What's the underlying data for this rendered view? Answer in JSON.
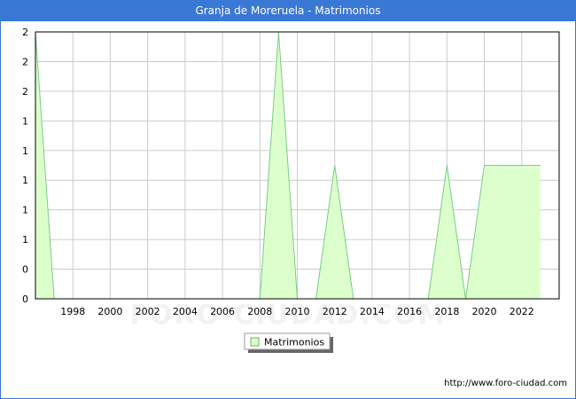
{
  "header": {
    "title": "Granja de Moreruela - Matrimonios"
  },
  "watermark": "FORO-CIUDAD.COM",
  "footer": {
    "url": "http://www.foro-ciudad.com"
  },
  "colors": {
    "fill": "#ddffcc",
    "line": "#77cc88",
    "title_bg": "#3a78d6",
    "grid": "#cccccc"
  },
  "chart_data": {
    "type": "area",
    "title": "Granja de Moreruela - Matrimonios",
    "x": [
      1996,
      1997,
      1998,
      1999,
      2000,
      2001,
      2002,
      2003,
      2004,
      2005,
      2006,
      2007,
      2008,
      2009,
      2010,
      2011,
      2012,
      2013,
      2014,
      2015,
      2016,
      2017,
      2018,
      2019,
      2020,
      2021,
      2022,
      2023
    ],
    "series": [
      {
        "name": "Matrimonios",
        "values": [
          2,
          0,
          0,
          0,
          0,
          0,
          0,
          0,
          0,
          0,
          0,
          0,
          0,
          2,
          0,
          0,
          1,
          0,
          0,
          0,
          0,
          0,
          1,
          0,
          1,
          1,
          1,
          1
        ]
      }
    ],
    "xlim": [
      1996,
      2024
    ],
    "ylim": [
      0,
      2
    ],
    "x_ticks": [
      1998,
      2000,
      2002,
      2004,
      2006,
      2008,
      2010,
      2012,
      2014,
      2016,
      2018,
      2020,
      2022
    ],
    "y_tick_labels": [
      "0",
      "0",
      "1",
      "1",
      "1",
      "1",
      "1",
      "2",
      "2",
      "2"
    ],
    "grid": true,
    "legend": "bottom-center"
  }
}
